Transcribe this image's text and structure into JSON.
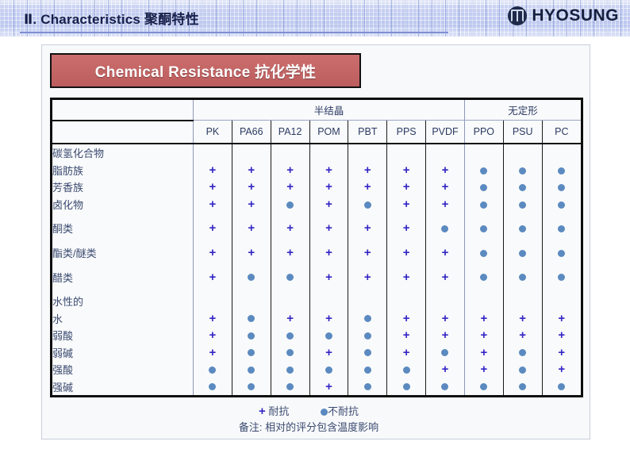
{
  "header": {
    "title": "Ⅱ. Characteristics 聚酮特性",
    "brand": "HYOSUNG",
    "brand_mark_icon": "hyosung-logo-icon"
  },
  "section": {
    "banner_title": "Chemical Resistance 抗化学性"
  },
  "table": {
    "groups": [
      {
        "label": "半结晶",
        "span": 7
      },
      {
        "label": "无定形",
        "span": 3
      }
    ],
    "columns": [
      "PK",
      "PA66",
      "PA12",
      "POM",
      "PBT",
      "PPS",
      "PVDF",
      "PPO",
      "PSU",
      "PC"
    ],
    "rows": [
      {
        "label": "碳氢化合物",
        "indent": 0,
        "type": "group",
        "values": []
      },
      {
        "label": "脂肪族",
        "indent": 1,
        "type": "data",
        "values": [
          "+",
          "+",
          "+",
          "+",
          "+",
          "+",
          "+",
          "o",
          "o",
          "o"
        ]
      },
      {
        "label": "芳香族",
        "indent": 1,
        "type": "data",
        "values": [
          "+",
          "+",
          "+",
          "+",
          "+",
          "+",
          "+",
          "o",
          "o",
          "o"
        ]
      },
      {
        "label": "卤化物",
        "indent": 1,
        "type": "data",
        "values": [
          "+",
          "+",
          "o",
          "+",
          "o",
          "+",
          "+",
          "o",
          "o",
          "o"
        ]
      },
      {
        "label": "",
        "indent": 0,
        "type": "spacer",
        "values": []
      },
      {
        "label": "酮类",
        "indent": 0,
        "type": "data",
        "values": [
          "+",
          "+",
          "+",
          "+",
          "+",
          "+",
          "o",
          "o",
          "o",
          "o"
        ]
      },
      {
        "label": "",
        "indent": 0,
        "type": "spacer",
        "values": []
      },
      {
        "label": "酯类/醚类",
        "indent": 0,
        "type": "data",
        "values": [
          "+",
          "+",
          "+",
          "+",
          "+",
          "+",
          "+",
          "o",
          "o",
          "o"
        ]
      },
      {
        "label": "",
        "indent": 0,
        "type": "spacer",
        "values": []
      },
      {
        "label": "醋类",
        "indent": 0,
        "type": "data",
        "values": [
          "+",
          "o",
          "o",
          "+",
          "+",
          "+",
          "+",
          "o",
          "o",
          "o"
        ]
      },
      {
        "label": "",
        "indent": 0,
        "type": "spacer",
        "values": []
      },
      {
        "label": "水性的",
        "indent": 0,
        "type": "group",
        "values": []
      },
      {
        "label": "水",
        "indent": 2,
        "type": "data",
        "values": [
          "+",
          "o",
          "+",
          "+",
          "o",
          "+",
          "+",
          "+",
          "+",
          "+"
        ]
      },
      {
        "label": "弱酸",
        "indent": 2,
        "type": "data",
        "values": [
          "+",
          "o",
          "o",
          "o",
          "o",
          "+",
          "+",
          "+",
          "+",
          "+"
        ]
      },
      {
        "label": "弱碱",
        "indent": 2,
        "type": "data",
        "values": [
          "+",
          "o",
          "o",
          "+",
          "o",
          "+",
          "o",
          "+",
          "o",
          "+"
        ]
      },
      {
        "label": "强酸",
        "indent": 2,
        "type": "data",
        "values": [
          "o",
          "o",
          "o",
          "o",
          "o",
          "o",
          "+",
          "+",
          "o",
          "+"
        ]
      },
      {
        "label": "强碱",
        "indent": 2,
        "type": "data",
        "values": [
          "o",
          "o",
          "o",
          "+",
          "o",
          "o",
          "o",
          "o",
          "o",
          "o"
        ]
      }
    ]
  },
  "legend": {
    "resistant_symbol": "+",
    "resistant_label": "耐抗",
    "not_resistant_symbol": "●",
    "not_resistant_label": "不耐抗",
    "note": "备注: 相对的评分包含温度影响"
  },
  "colors": {
    "header_band": "#c3cdf0",
    "banner_red": "#c46565",
    "plus_blue": "#3326c4",
    "dot_blue": "#5b8ac0",
    "text_navy": "#2b3a63"
  }
}
